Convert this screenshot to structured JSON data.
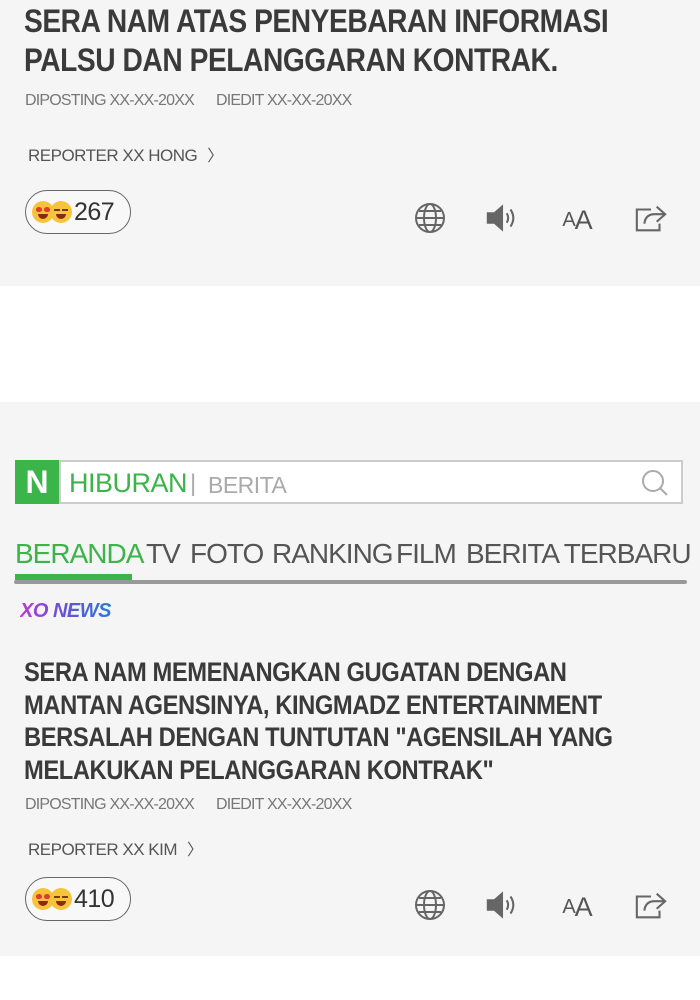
{
  "article1": {
    "headline": "SERA NAM ATAS PENYEBARAN INFORMASI PALSU DAN PELANGGARAN KONTRAK.",
    "posted": "DIPOSTING XX-XX-20XX",
    "edited": "DIEDIT XX-XX-20XX",
    "reporter": "REPORTER XX HONG",
    "reporter_chevron": "〉",
    "reaction_count": "267"
  },
  "nav": {
    "logo_letter": "N",
    "section": "HIBURAN",
    "separator": "|",
    "subsection": "BERITA",
    "tabs": [
      "BERANDA",
      "TV",
      "FOTO",
      "RANKING",
      "FILM",
      "BERITA TERBARU"
    ],
    "active_tab": "BERANDA"
  },
  "article2": {
    "source": "XO NEWS",
    "headline": "SERA NAM MEMENANGKAN GUGATAN DENGAN MANTAN AGENSINYA, KINGMADZ ENTERTAINMENT BERSALAH DENGAN TUNTUTAN \"AGENSILAH YANG MELAKUKAN PELANGGARAN KONTRAK\"",
    "posted": "DIPOSTING XX-XX-20XX",
    "edited": "DIEDIT XX-XX-20XX",
    "reporter": "REPORTER XX KIM",
    "reporter_chevron": "〉",
    "reaction_count": "410"
  },
  "toolbar": {
    "font_small": "A",
    "font_large": "A",
    "icons": [
      "globe-icon",
      "speaker-icon",
      "font-size-icon",
      "share-icon"
    ]
  },
  "colors": {
    "brand_green": "#3bb44a",
    "panel_bg": "#f5f5f5",
    "tab_rule": "#999999"
  }
}
